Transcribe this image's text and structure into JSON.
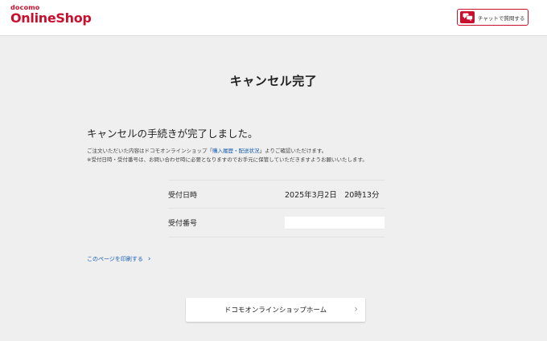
{
  "header": {
    "logo_small": "docomo",
    "logo_big": "OnlineShop",
    "chat_button_label": "チャットで質問する"
  },
  "main": {
    "title": "キャンセル完了",
    "subtitle": "キャンセルの手続きが完了しました。",
    "notice_line1_before": "ご注文いただいた内容はドコモオンラインショップ「",
    "notice_link": "購入履歴・配送状況",
    "notice_line1_after": "」よりご確認いただけます。",
    "notice_line2": "※受付日時・受付番号は、お問い合わせ時に必要となりますのでお手元に保管していただきますようお願いいたします。",
    "rows": [
      {
        "label": "受付日時",
        "value": "2025年3月2日　20時13分"
      },
      {
        "label": "受付番号",
        "value": ""
      }
    ],
    "print_link": "このページを印刷する",
    "home_button": "ドコモオンラインショップホーム"
  },
  "colors": {
    "brand": "#c8102e",
    "link": "#1a5fb4",
    "background": "#efefef"
  },
  "icons": {
    "chat": "chat-bubbles-icon",
    "chevron": "chevron-right-icon"
  }
}
